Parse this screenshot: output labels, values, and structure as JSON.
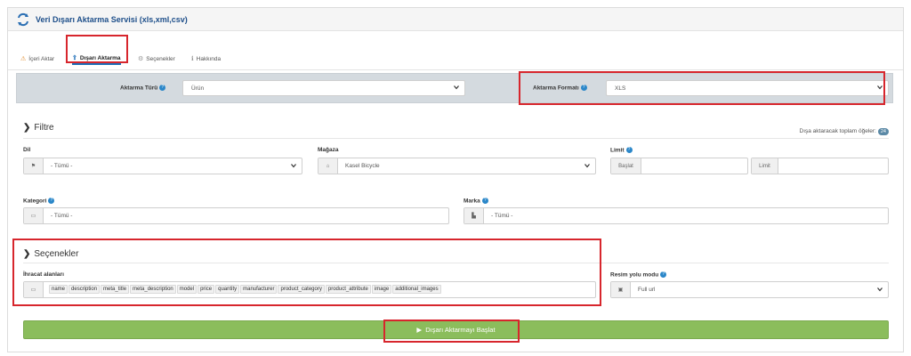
{
  "header": {
    "title": "Veri Dışarı Aktarma Servisi (xls,xml,csv)"
  },
  "tabs": [
    {
      "label": "İçeri Aktar"
    },
    {
      "label": "Dışarı Aktarma"
    },
    {
      "label": "Seçenekler"
    },
    {
      "label": "Hakkında"
    }
  ],
  "topbar": {
    "type_label": "Aktarma Türü",
    "type_value": "Ürün",
    "format_label": "Aktarma Formatı",
    "format_value": "XLS"
  },
  "filter": {
    "title": "Filtre",
    "count_label": "Dışa aktaracak toplam öğeler:",
    "count": "24",
    "language_label": "Dil",
    "language_value": "- Tümü -",
    "store_label": "Mağaza",
    "store_value": "Kasel Bicycle",
    "limit_label": "Limit",
    "limit_start": "Başlat",
    "limit_end": "Limit",
    "category_label": "Kategori",
    "category_value": "- Tümü -",
    "brand_label": "Marka",
    "brand_value": "- Tümü -"
  },
  "options": {
    "title": "Seçenekler",
    "fields_label": "İhracat alanları",
    "fields": [
      "name",
      "description",
      "meta_title",
      "meta_description",
      "model",
      "price",
      "quantity",
      "manufacturer",
      "product_category",
      "product_attribute",
      "image",
      "additional_images"
    ],
    "image_mode_label": "Resim yolu modu",
    "image_mode_value": "Full url"
  },
  "actions": {
    "start_label": "Dışarı Aktarmayı Başlat"
  },
  "colors": {
    "accent": "#1e4f8a",
    "start_button": "#8bbd5c",
    "highlight": "#d7262d"
  }
}
